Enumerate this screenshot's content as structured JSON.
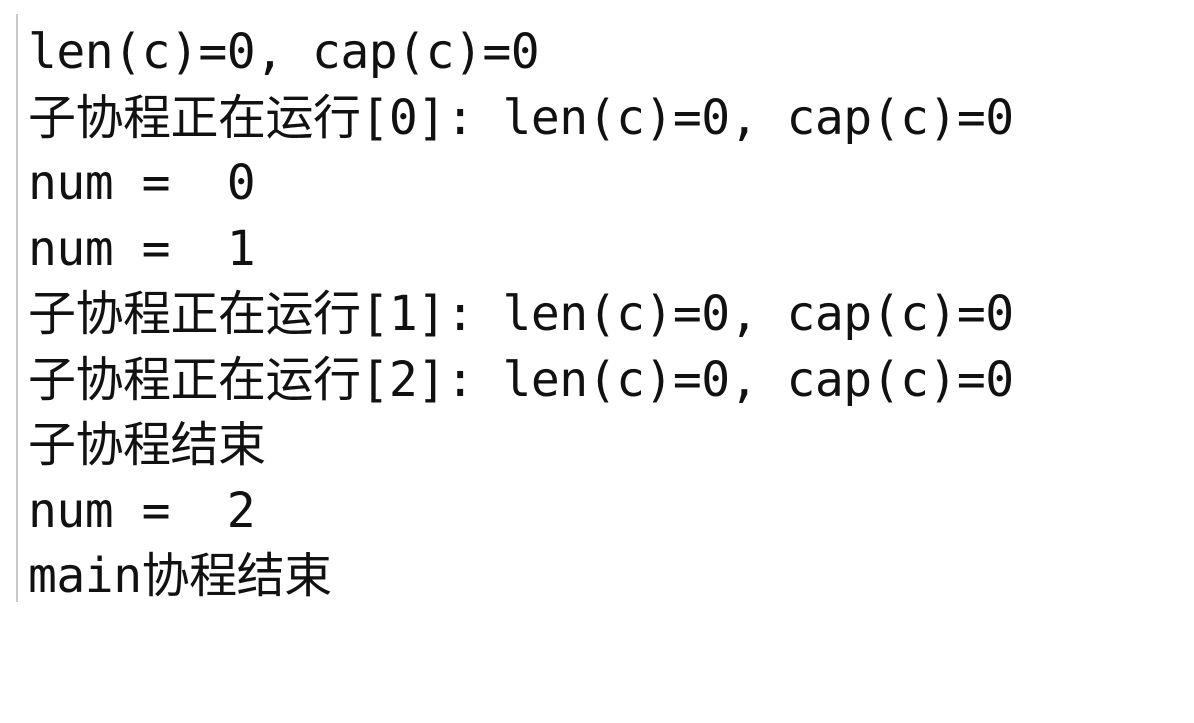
{
  "console": {
    "lines": [
      "len(c)=0, cap(c)=0",
      "子协程正在运行[0]: len(c)=0, cap(c)=0",
      "num =  0",
      "num =  1",
      "子协程正在运行[1]: len(c)=0, cap(c)=0",
      "子协程正在运行[2]: len(c)=0, cap(c)=0",
      "子协程结束",
      "num =  2",
      "main协程结束"
    ]
  }
}
